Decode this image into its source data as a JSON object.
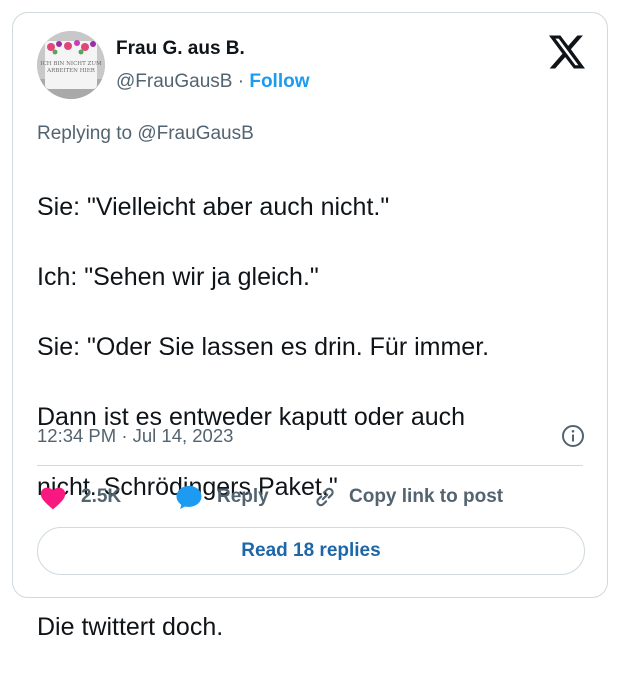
{
  "author": {
    "display_name": "Frau G. aus B.",
    "handle": "@FrauGausB",
    "separator": " · ",
    "follow_label": "Follow",
    "avatar_text": [
      "ICH BIN NICHT ZUM",
      "ARBEITEN HIER"
    ]
  },
  "reply_context": "Replying to @FrauGausB",
  "tweet": {
    "lines": [
      "Sie: \"Vielleicht aber auch nicht.\"",
      "Ich: \"Sehen wir ja gleich.\"",
      "Sie: \"Oder Sie lassen es drin. Für immer.",
      "Dann ist es entweder kaputt oder auch",
      "nicht. Schrödingers Paket.\"",
      "",
      "Die twittert doch."
    ]
  },
  "timestamp": "12:34 PM · Jul 14, 2023",
  "actions": {
    "like_count": "2.5K",
    "reply_label": "Reply",
    "copy_label": "Copy link to post"
  },
  "read_replies_label": "Read 18 replies",
  "icons": {
    "brand": "x-logo-icon",
    "info": "info-icon",
    "like": "heart-icon",
    "reply": "speech-bubble-icon",
    "copy": "link-icon"
  },
  "colors": {
    "accent": "#1d9bf0",
    "like": "#f91880",
    "muted": "#536471",
    "text": "#0f1419",
    "border": "#cfd9de"
  }
}
